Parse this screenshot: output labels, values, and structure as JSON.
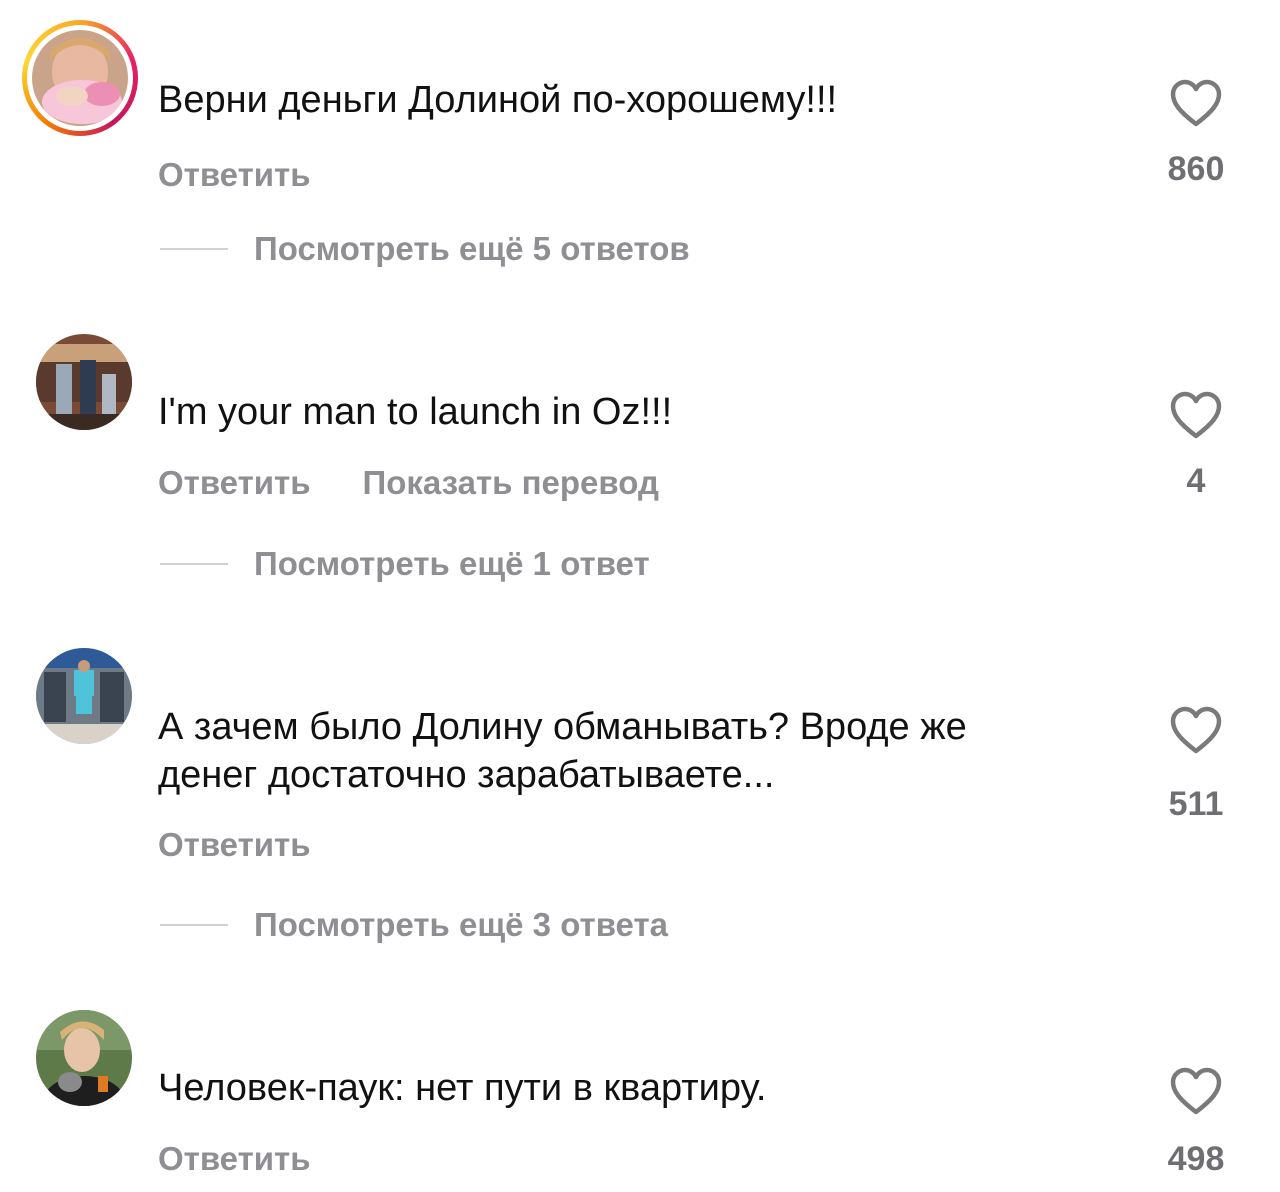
{
  "comments": [
    {
      "text": "Верни деньги Долиной по-хорошему!!!",
      "actions": [
        "Ответить"
      ],
      "likes": "860",
      "replies": "Посмотреть ещё 5 ответов",
      "avatar": "avatar-with-story-ring"
    },
    {
      "text": "I'm your man to launch in Oz!!!",
      "actions": [
        "Ответить",
        "Показать перевод"
      ],
      "likes": "4",
      "replies": "Посмотреть ещё 1 ответ",
      "avatar": "avatar-photo"
    },
    {
      "text": "А зачем было Долину обманывать? Вроде же\nденег достаточно зарабатываете...",
      "actions": [
        "Ответить"
      ],
      "likes": "511",
      "replies": "Посмотреть ещё 3 ответа",
      "avatar": "avatar-photo"
    },
    {
      "text": "Человек-паук: нет пути в квартиру.",
      "actions": [
        "Ответить"
      ],
      "likes": "498",
      "avatar": "avatar-photo"
    }
  ],
  "icons": {
    "like": "heart-outline-icon"
  },
  "colors": {
    "text": "#111111",
    "secondary": "#8e8e93",
    "like_count": "#6e6e73",
    "divider": "#d1d1d6",
    "story_ring_start": "#f9a825",
    "story_ring_end": "#e91e63"
  }
}
